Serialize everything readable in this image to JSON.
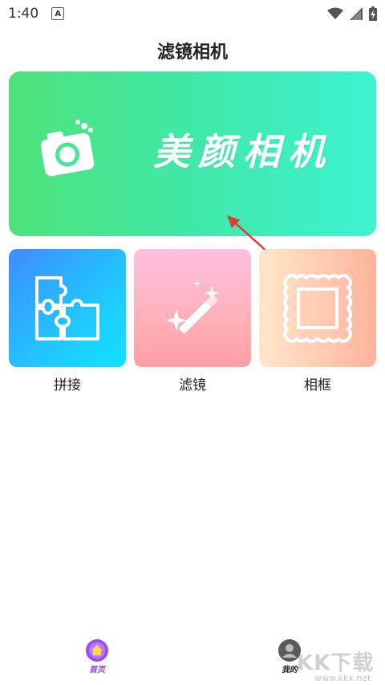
{
  "status": {
    "time": "1:40",
    "a_badge": "A"
  },
  "page": {
    "title": "滤镜相机"
  },
  "banner": {
    "text": "美颜相机"
  },
  "features": [
    {
      "label": "拼接",
      "icon": "puzzle-icon"
    },
    {
      "label": "滤镜",
      "icon": "magic-wand-icon"
    },
    {
      "label": "相框",
      "icon": "frame-icon"
    }
  ],
  "tabs": [
    {
      "label": "首页",
      "icon": "home-icon",
      "active": true
    },
    {
      "label": "我的",
      "icon": "user-icon",
      "active": false
    }
  ],
  "watermark": {
    "text": "KK下载",
    "url": "www.kkx.net"
  },
  "colors": {
    "banner_start": "#4fe27a",
    "banner_end": "#3ef3d2",
    "tab_active": "#8f3fe0",
    "arrow": "#e53935"
  }
}
